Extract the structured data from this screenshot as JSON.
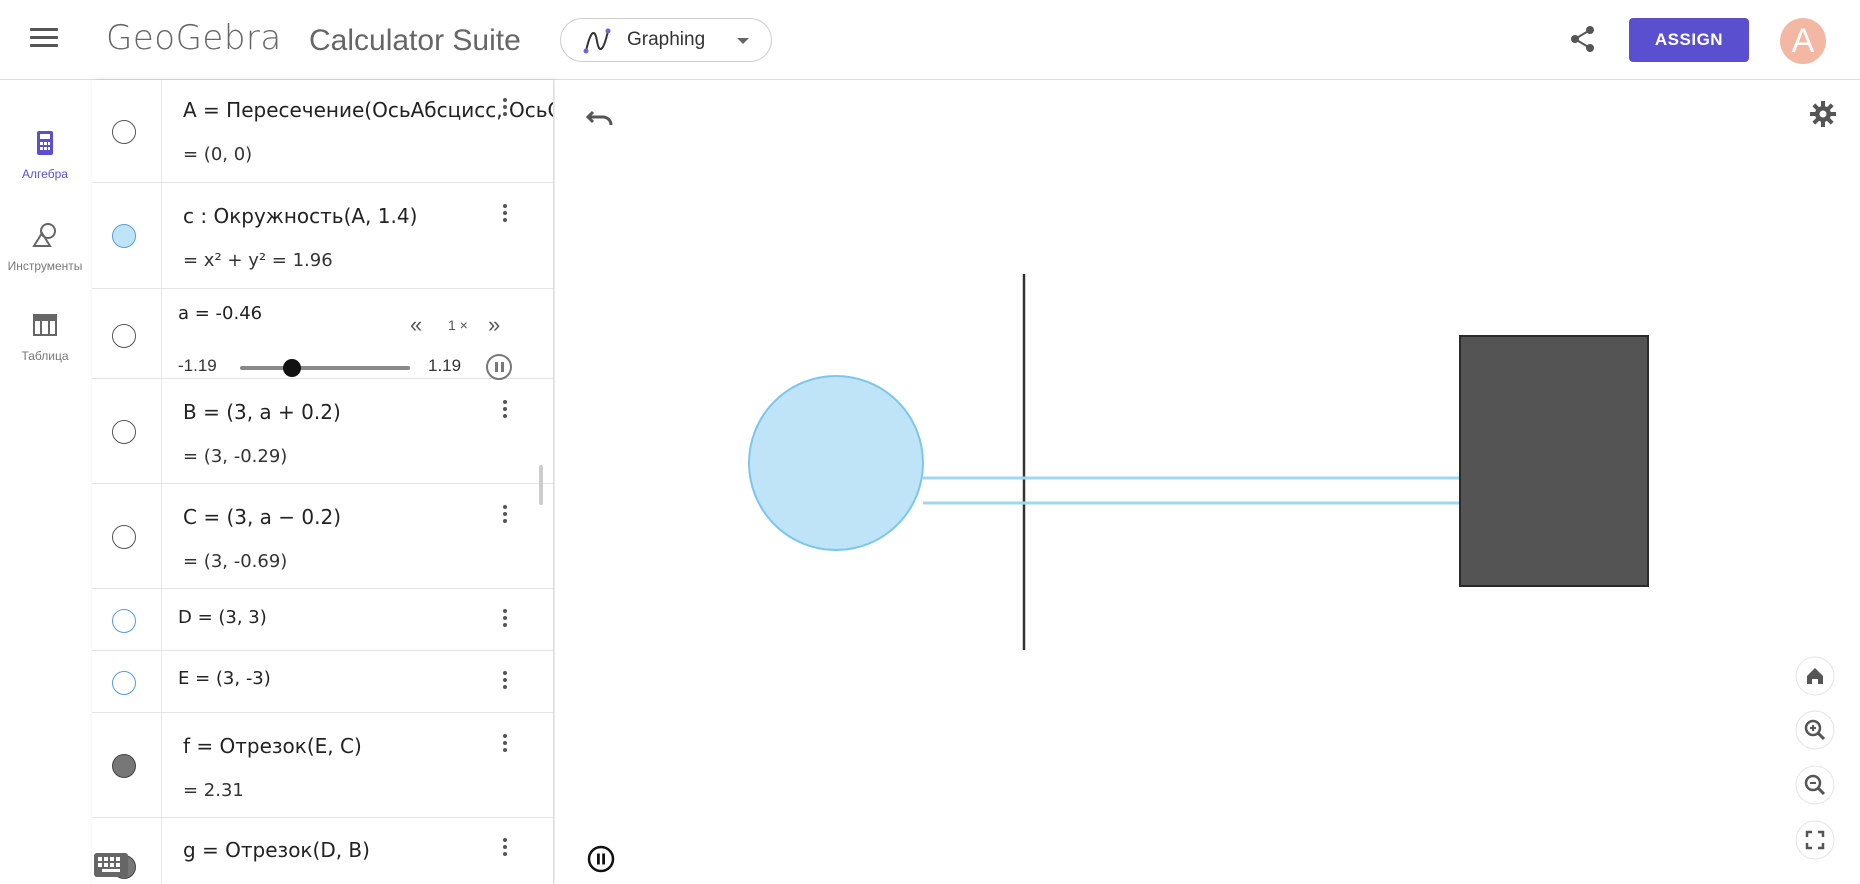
{
  "header": {
    "brand": "GeoGebra",
    "suite_title": "Calculator Suite",
    "app_selector": "Graphing",
    "assign_label": "ASSIGN",
    "avatar_letter": "A"
  },
  "rail": [
    {
      "label": "Алгебра",
      "icon": "calculator-icon",
      "active": true
    },
    {
      "label": "Инструменты",
      "icon": "shapes-icon",
      "active": false
    },
    {
      "label": "Таблица",
      "icon": "table-icon",
      "active": false
    }
  ],
  "algebra": {
    "rows": [
      {
        "def": "A = Пересечение(ОсьАбсцисс, ОсьО",
        "val": "= (0, 0)"
      },
      {
        "def": "c : Окружность(A, 1.4)",
        "val": "= x² + y² = 1.96"
      },
      {
        "def": "B = (3, a + 0.2)",
        "val": "= (3, -0.29)"
      },
      {
        "def": "C = (3, a − 0.2)",
        "val": "= (3, -0.69)"
      },
      {
        "def": "D = (3, 3)"
      },
      {
        "def": "E = (3, -3)"
      },
      {
        "def": "f = Отрезок(E, C)",
        "val": "= 2.31"
      },
      {
        "def": "g = Отрезок(D, B)"
      }
    ],
    "slider": {
      "label": "a = -0.46",
      "value": -0.46,
      "min_label": "-1.19",
      "max_label": "1.19",
      "min": -1.19,
      "max": 1.19,
      "speed_label": "1 ×",
      "back_glyph": "«",
      "fwd_glyph": "»"
    }
  },
  "colors": {
    "accent": "#5a4fcf",
    "circle_fill": "#bfe4f7",
    "circle_stroke": "#7cc6ea",
    "rect_fill": "#545454"
  }
}
